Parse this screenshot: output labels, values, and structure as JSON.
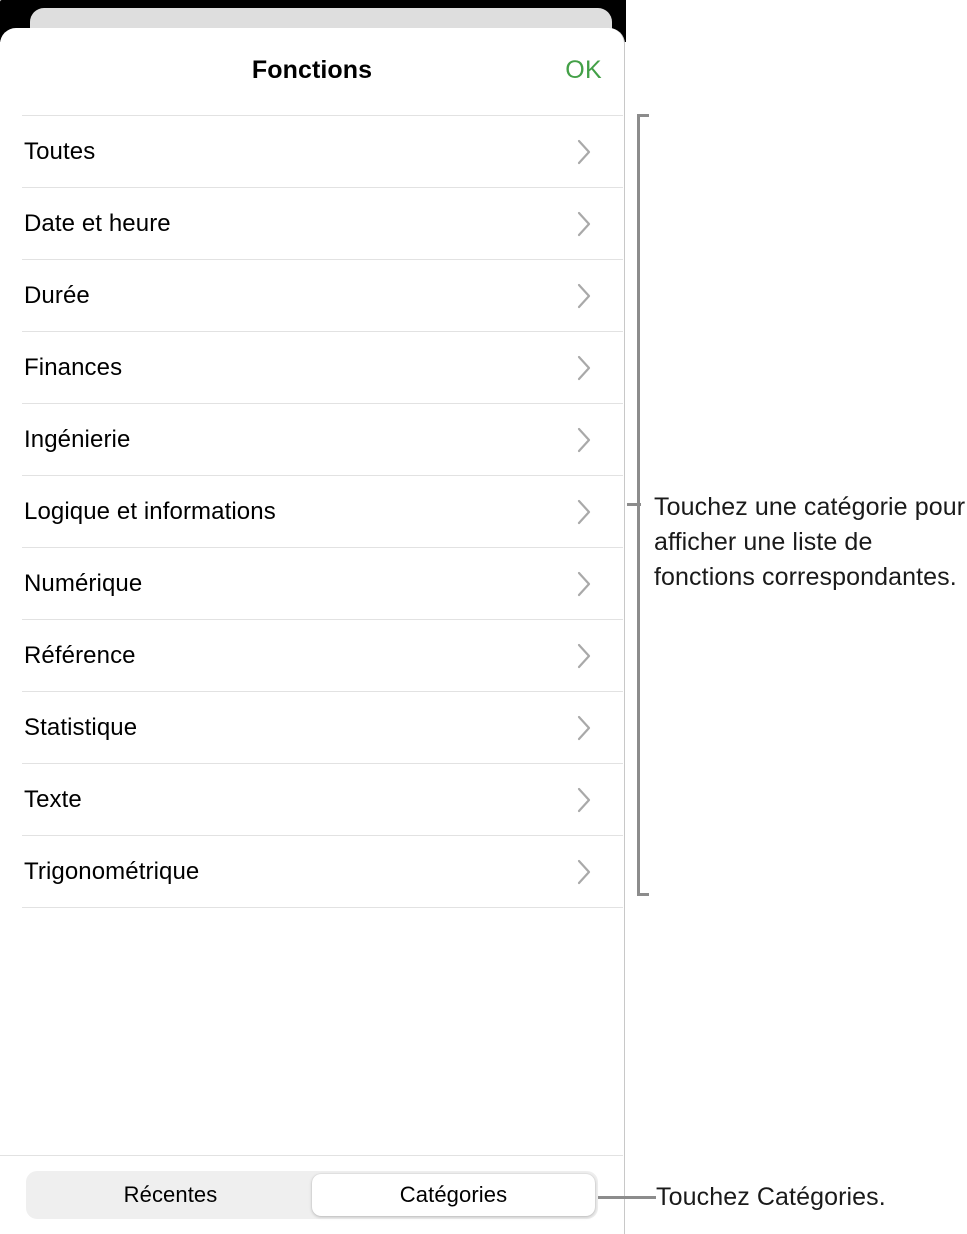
{
  "sheet": {
    "title": "Fonctions",
    "ok_label": "OK"
  },
  "categories": [
    {
      "label": "Toutes",
      "chevron": "chevron-right-icon"
    },
    {
      "label": "Date et heure",
      "chevron": "chevron-right-icon"
    },
    {
      "label": "Durée",
      "chevron": "chevron-right-icon"
    },
    {
      "label": "Finances",
      "chevron": "chevron-right-icon"
    },
    {
      "label": "Ingénierie",
      "chevron": "chevron-right-icon"
    },
    {
      "label": "Logique et informations",
      "chevron": "chevron-right-icon"
    },
    {
      "label": "Numérique",
      "chevron": "chevron-right-icon"
    },
    {
      "label": "Référence",
      "chevron": "chevron-right-icon"
    },
    {
      "label": "Statistique",
      "chevron": "chevron-right-icon"
    },
    {
      "label": "Texte",
      "chevron": "chevron-right-icon"
    },
    {
      "label": "Trigonométrique",
      "chevron": "chevron-right-icon"
    }
  ],
  "segmented": {
    "recent_label": "Récentes",
    "categories_label": "Catégories",
    "selected": "Catégories"
  },
  "callouts": {
    "list": "Touchez une catégorie pour afficher une liste de fonctions correspondantes.",
    "segment": "Touchez Catégories."
  },
  "colors": {
    "ok_green": "#43a047",
    "separator": "#e2e2e2",
    "bracket": "#8c8c8c",
    "segment_track": "#efefef",
    "device_chip": "#dedede"
  }
}
